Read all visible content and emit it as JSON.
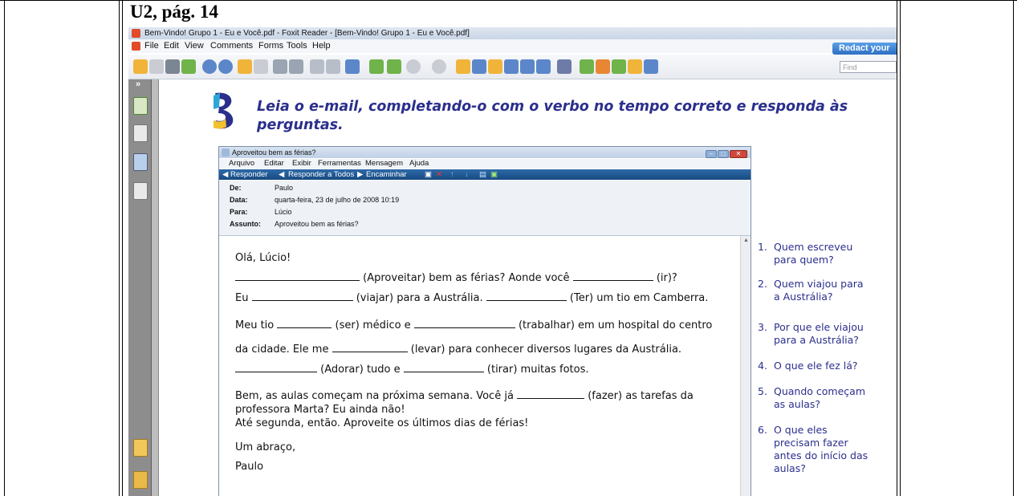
{
  "document": {
    "heading": "U2, pág. 14"
  },
  "window": {
    "title": "Bem-Vindo! Grupo 1 - Eu e Você.pdf - Foxit Reader - [Bem-Vindo! Grupo 1 - Eu e Você.pdf]",
    "menu": [
      "File",
      "Edit",
      "View",
      "Comments",
      "Forms",
      "Tools",
      "Help"
    ],
    "redact_label": "Redact your",
    "find_placeholder": "Find"
  },
  "page": {
    "instruction_line1": "Leia o e-mail, completando-o com o verbo no tempo correto e responda às",
    "instruction_line2": "perguntas."
  },
  "email": {
    "window_title": "Aproveitou bem as férias?",
    "menu": [
      "Arquivo",
      "Editar",
      "Exibir",
      "Ferramentas",
      "Mensagem",
      "Ajuda"
    ],
    "toolbar": [
      "Responder",
      "Responder a Todos",
      "Encaminhar"
    ],
    "headers": [
      {
        "label": "De:",
        "value": "Paulo"
      },
      {
        "label": "Data:",
        "value": "quarta-feira, 23 de julho de 2008 10:19"
      },
      {
        "label": "Para:",
        "value": "Lúcio"
      },
      {
        "label": "Assunto:",
        "value": "Aproveitou bem as férias?"
      }
    ],
    "greeting": "Olá, Lúcio!",
    "l1a": "(Aproveitar) bem as férias? Aonde você",
    "l1b": "(ir)?",
    "l2a": "Eu",
    "l2b": "(viajar) para a Austrália.",
    "l2c": "(Ter) um tio em Camberra.",
    "l3a": "Meu tio",
    "l3b": "(ser) médico e",
    "l3c": "(trabalhar) em um hospital do centro",
    "l4a": "da cidade. Ele me",
    "l4b": "(levar) para conhecer diversos lugares da Austrália.",
    "l5a": "(Adorar) tudo e",
    "l5b": "(tirar) muitas fotos.",
    "l6a": "Bem, as aulas começam na próxima semana. Você já",
    "l6b": "(fazer) as tarefas da",
    "l7": "professora Marta? Eu ainda não!",
    "l8": "Até segunda, então. Aproveite os últimos dias de férias!",
    "closing": "Um abraço,",
    "signature": "Paulo"
  },
  "questions": [
    {
      "num": "1.",
      "line1": "Quem escreveu",
      "line2": "para quem?"
    },
    {
      "num": "2.",
      "line1": "Quem viajou para",
      "line2": "a Austrália?"
    },
    {
      "num": "3.",
      "line1": "Por que ele viajou",
      "line2": "para a Austrália?"
    },
    {
      "num": "4.",
      "line1": "O que ele fez lá?",
      "line2": ""
    },
    {
      "num": "5.",
      "line1": "Quando começam",
      "line2": "as aulas?"
    },
    {
      "num": "6.",
      "line1": "O que eles",
      "line2": "precisam fazer",
      "line3": "antes do início das",
      "line4": "aulas?"
    }
  ]
}
